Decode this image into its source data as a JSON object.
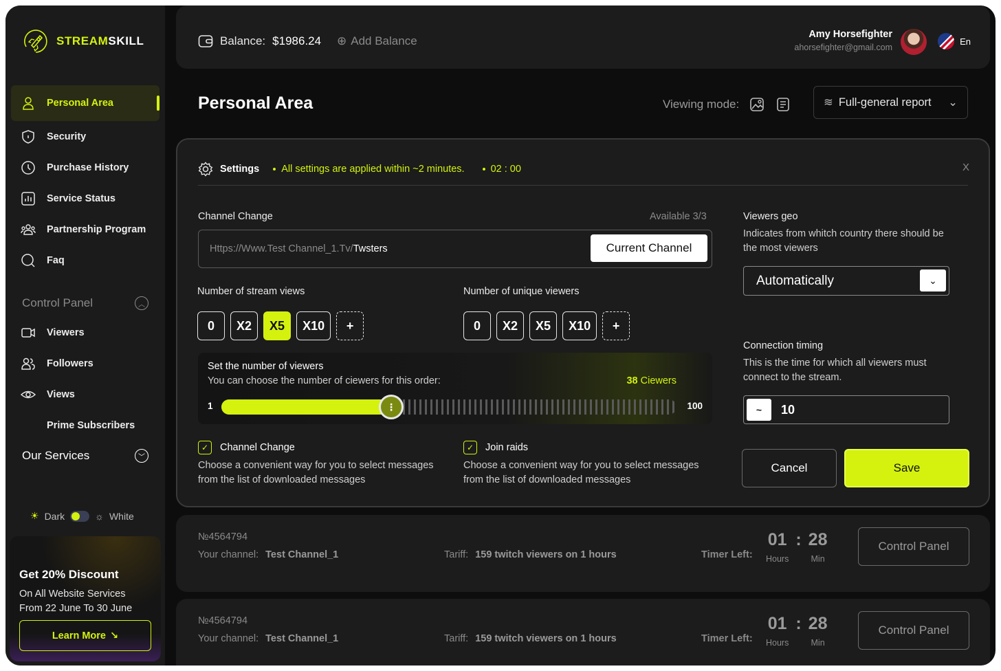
{
  "brand": {
    "name_accent": "STREAM",
    "name_rest": "SKILL"
  },
  "sidebar": {
    "items": [
      {
        "label": "Personal Area"
      },
      {
        "label": "Security"
      },
      {
        "label": "Purchase History"
      },
      {
        "label": "Service Status"
      },
      {
        "label": "Partnership Program"
      },
      {
        "label": "Faq"
      }
    ],
    "control_panel": {
      "title": "Control Panel",
      "items": [
        {
          "label": "Viewers"
        },
        {
          "label": "Followers"
        },
        {
          "label": "Views"
        },
        {
          "label": "Prime Subscribers"
        }
      ]
    },
    "our_services": "Our Services",
    "theme": {
      "dark": "Dark",
      "white": "White"
    },
    "promo": {
      "title": "Get 20% Discount",
      "line1": "On All Website Services",
      "line2": "From 22 June To 30 June",
      "button": "Learn More"
    }
  },
  "topbar": {
    "balance_label": "Balance:",
    "balance_value": "$1986.24",
    "add_balance": "Add Balance",
    "user_name": "Amy Horsefighter",
    "user_email": "ahorsefighter@gmail.com",
    "lang": "En"
  },
  "page": {
    "title": "Personal Area",
    "viewing_mode": "Viewing mode:",
    "report": "Full-general report"
  },
  "settings": {
    "title": "Settings",
    "note": "All settings are applied within ~2 minutes.",
    "timer": "02 : 00",
    "close": "X",
    "channel_change": "Channel Change",
    "available": "Available 3/3",
    "url_prefix": "Https://Www.Test Channel_1.Tv/",
    "url_suffix": "Twsters",
    "current_channel": "Current Channel",
    "stream_views_label": "Number of stream views",
    "unique_viewers_label": "Number of unique viewers",
    "stream_views_options": [
      "0",
      "X2",
      "X5",
      "X10",
      "+"
    ],
    "stream_views_selected": 2,
    "unique_viewers_options": [
      "0",
      "X2",
      "X5",
      "X10",
      "+"
    ],
    "slider": {
      "title": "Set the number of viewers",
      "subtitle": "You can choose the number of ciewers for this order:",
      "count_num": "38",
      "count_unit": "Ciewers",
      "min": "1",
      "max": "100",
      "value": 38
    },
    "check_channel": "Channel Change",
    "check_raids": "Join raids",
    "check_desc": "Choose a convenient way for you to select messages from the list of downloaded messages",
    "geo_title": "Viewers geo",
    "geo_desc": "Indicates from whitch country there should be the most viewers",
    "geo_value": "Automatically",
    "timing_title": "Connection timing",
    "timing_desc": "This is the time for which all viewers must connect to the stream.",
    "timing_prefix": "~",
    "timing_value": "10",
    "cancel": "Cancel",
    "save": "Save"
  },
  "orders": [
    {
      "num": "№4564794",
      "channel_label": "Your channel:",
      "channel": "Test Channel_1",
      "tariff_label": "Tariff:",
      "tariff": "159 twitch viewers on 1 hours",
      "timer_label": "Timer Left:",
      "hours": "01",
      "min": "28",
      "hours_label": "Hours",
      "min_label": "Min",
      "button": "Control Panel"
    },
    {
      "num": "№4564794",
      "channel_label": "Your channel:",
      "channel": "Test Channel_1",
      "tariff_label": "Tariff:",
      "tariff": "159 twitch viewers on 1 hours",
      "timer_label": "Timer Left:",
      "hours": "01",
      "min": "28",
      "hours_label": "Hours",
      "min_label": "Min",
      "button": "Control Panel"
    }
  ],
  "colors": {
    "accent": "#d4f20e",
    "bg": "#0d0d0d",
    "panel": "#1c1c1c"
  }
}
